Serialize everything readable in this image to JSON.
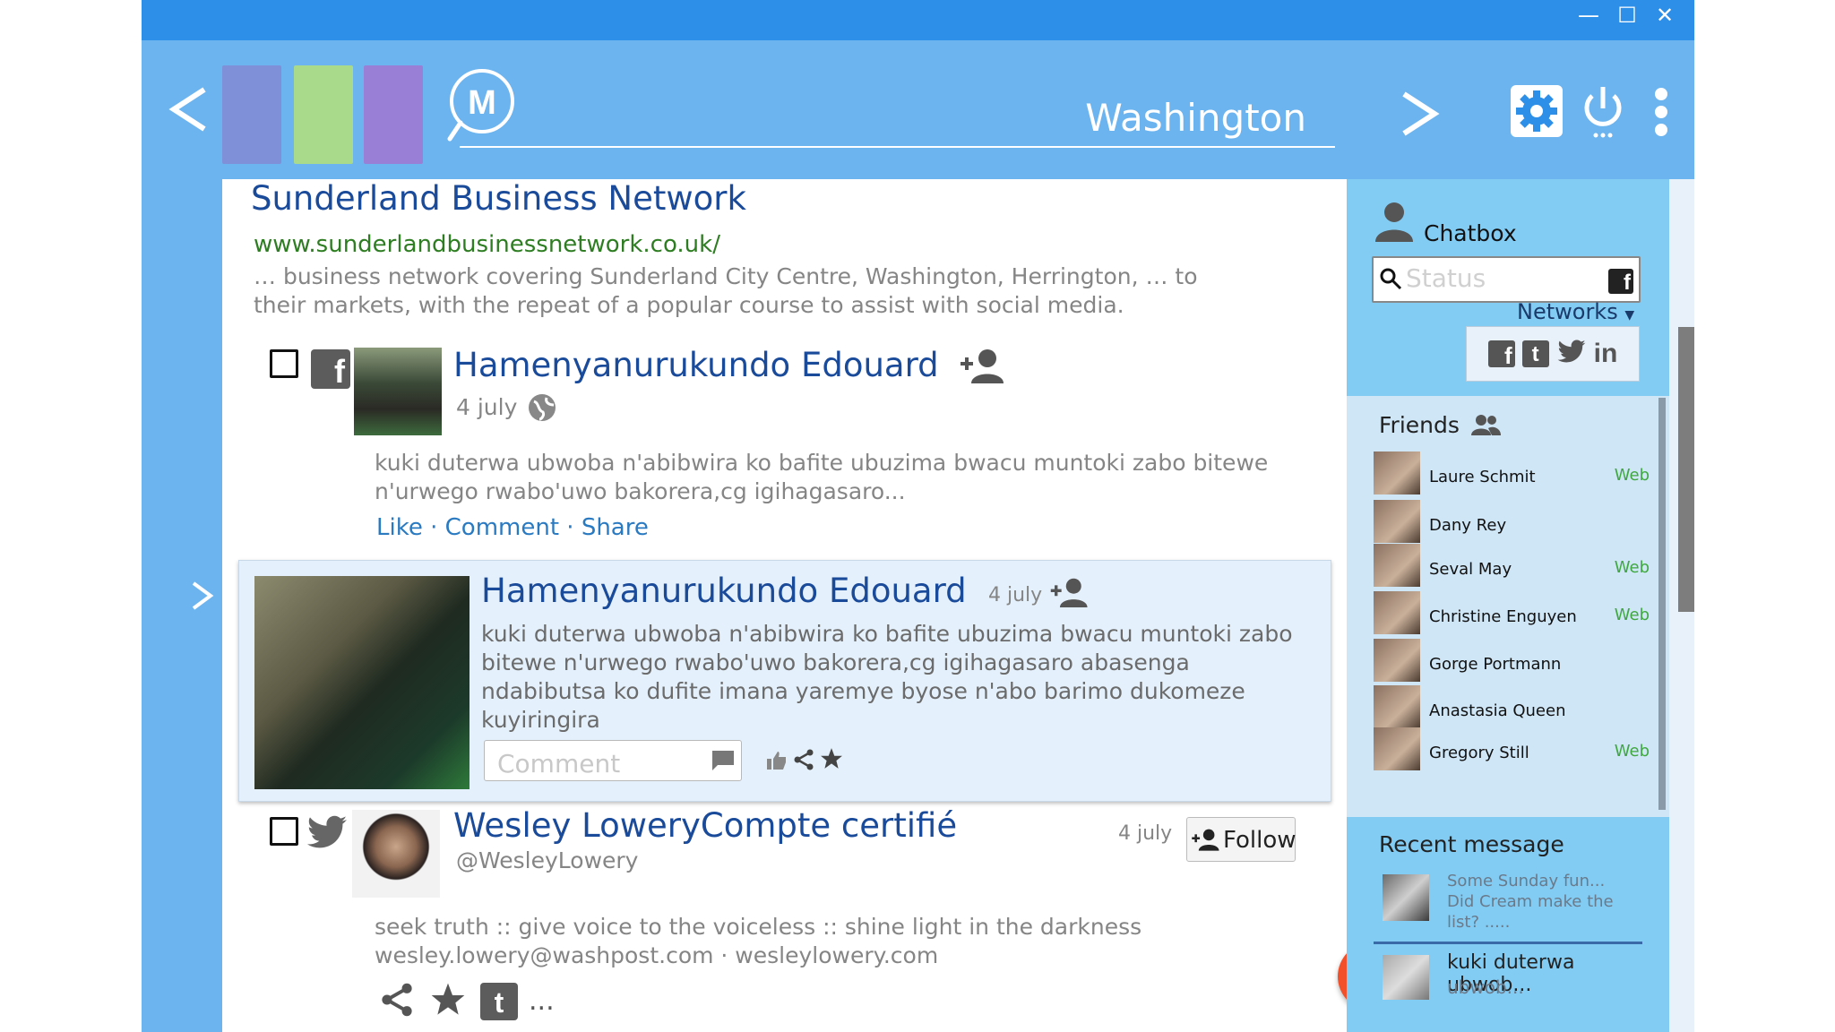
{
  "window": {
    "minimize": "—",
    "maximize": "☐",
    "close": "✕"
  },
  "toolbar": {
    "search_value": "Washington",
    "tiles": [
      "#7f8fd8",
      "#a9d98a",
      "#9a7fd6"
    ],
    "logo_text": "M"
  },
  "result": {
    "title": "Sunderland Business Network",
    "url": "www.sunderlandbusinessnetwork.co.uk/",
    "snippet_1": "… business network covering Sunderland City Centre, Washington, Herrington, … to",
    "snippet_2": "their markets, with the repeat of a popular course to assist with social media."
  },
  "post1": {
    "author": "Hamenyanurukundo Edouard",
    "date": "4 july",
    "text_1": "kuki duterwa ubwoba n'abibwira ko bafite ubuzima bwacu muntoki zabo bitewe",
    "text_2": "n'urwego rwabo'uwo bakorera,cg igihagasaro...",
    "like": "Like",
    "sep": "·",
    "comment": "Comment",
    "share": "Share"
  },
  "expanded": {
    "author": "Hamenyanurukundo Edouard",
    "date": "4 july",
    "text_1": "kuki duterwa ubwoba n'abibwira ko bafite ubuzima bwacu muntoki zabo",
    "text_2": "bitewe n'urwego rwabo'uwo bakorera,cg igihagasaro abasenga",
    "text_3": "ndabibutsa ko dufite imana yaremye byose n'abo barimo dukomeze",
    "text_4": "kuyiringira",
    "comment_placeholder": "Comment"
  },
  "post2": {
    "author": "Wesley LoweryCompte certifié",
    "date": "4 july",
    "handle": "@WesleyLowery",
    "follow": "Follow",
    "bio_1": "seek truth :: give voice to the voiceless :: shine light in the darkness",
    "bio_2": "wesley.lowery@washpost.com · wesleylowery.com",
    "more": "..."
  },
  "sidebar": {
    "chatbox": "Chatbox",
    "status_placeholder": "Status",
    "networks": "Networks",
    "friends_title": "Friends",
    "friends": [
      {
        "name": "Laure Schmit",
        "status": "Web"
      },
      {
        "name": "Dany Rey",
        "status": ""
      },
      {
        "name": "Seval May",
        "status": "Web"
      },
      {
        "name": "Christine Enguyen",
        "status": "Web"
      },
      {
        "name": "Gorge Portmann",
        "status": ""
      },
      {
        "name": "Anastasia Queen",
        "status": ""
      },
      {
        "name": "Gregory Still",
        "status": "Web"
      }
    ],
    "recent_title": "Recent message",
    "msg1_1": "Some Sunday fun...",
    "msg1_2": "Did Cream make the",
    "msg1_3": "list? .....",
    "msg2_1": "kuki duterwa ubwob...",
    "msg2_2": "ubwob..."
  },
  "fab": "+"
}
